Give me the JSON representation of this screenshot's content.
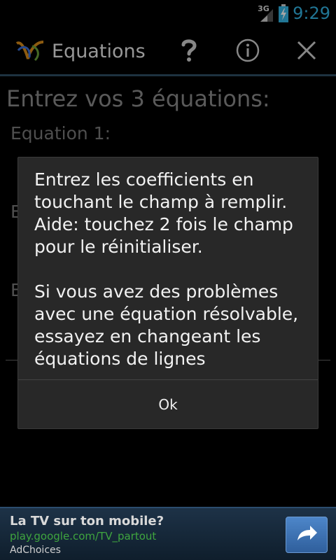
{
  "statusbar": {
    "network_type": "3G",
    "time": "9:29",
    "icons": [
      "signal-icon",
      "battery-charging-icon"
    ]
  },
  "actionbar": {
    "title": "Equations",
    "logo": "app-logo-icon",
    "buttons": [
      {
        "name": "help-button",
        "icon": "question-mark-icon"
      },
      {
        "name": "info-button",
        "icon": "info-icon"
      },
      {
        "name": "close-button",
        "icon": "close-icon"
      }
    ],
    "accent_line_color": "#2f4d63"
  },
  "background": {
    "heading": "Entrez vos 3 équations:",
    "equation1_label": "Equation 1:",
    "equation2_label_partial": "E",
    "equation3_label_partial": "E"
  },
  "dialog": {
    "message": "Entrez les coefficients en touchant le champ à remplir. Aide: touchez 2 fois le champ pour le réinitialiser.\n\nSi vous avez des problèmes avec une équation résolvable, essayez en changeant les équations de lignes",
    "ok_label": "Ok"
  },
  "ad": {
    "title": "La TV sur ton mobile?",
    "url": "play.google.com/TV_partout",
    "choices": "AdChoices",
    "button_icon": "share-arrow-icon"
  },
  "colors": {
    "time": "#33b5e5",
    "ad_url": "#3fa53f",
    "dialog_bg": "#282828"
  }
}
